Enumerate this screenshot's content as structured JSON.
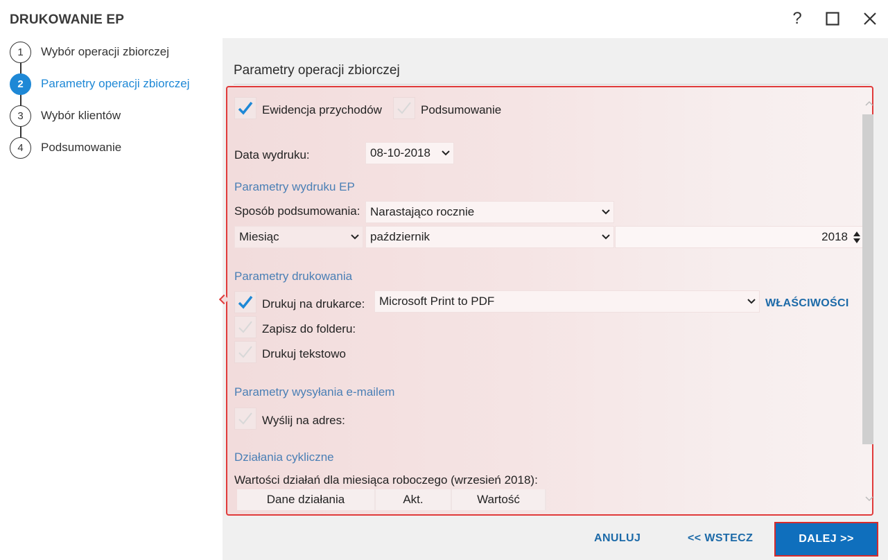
{
  "window": {
    "title": "DRUKOWANIE EP",
    "help_label": "?"
  },
  "steps": [
    {
      "number": "1",
      "label": "Wybór operacji zbiorczej",
      "active": false
    },
    {
      "number": "2",
      "label": "Parametry operacji zbiorczej",
      "active": true
    },
    {
      "number": "3",
      "label": "Wybór klientów",
      "active": false
    },
    {
      "number": "4",
      "label": "Podsumowanie",
      "active": false
    }
  ],
  "main": {
    "title": "Parametry operacji zbiorczej",
    "ewidencja": {
      "label": "Ewidencja przychodów",
      "checked": true
    },
    "podsumowanie": {
      "label": "Podsumowanie",
      "checked": false
    },
    "print_date": {
      "label": "Data wydruku:",
      "value": "08-10-2018"
    },
    "ep_section": "Parametry wydruku EP",
    "summary_mode": {
      "label": "Sposób podsumowania:",
      "value": "Narastająco rocznie"
    },
    "period_type": "Miesiąc",
    "month": "październik",
    "year": "2018",
    "print_section": "Parametry drukowania",
    "print_on_printer": {
      "label": "Drukuj na drukarce:",
      "checked": true,
      "printer": "Microsoft Print to PDF"
    },
    "properties_label": "WŁAŚCIWOŚCI",
    "save_to_folder": {
      "label": "Zapisz do folderu:",
      "checked": false
    },
    "print_text": {
      "label": "Drukuj tekstowo",
      "checked": false
    },
    "email_section": "Parametry wysyłania e-mailem",
    "send_to": {
      "label": "Wyślij na adres:",
      "checked": false
    },
    "cyclic_section": "Działania cykliczne",
    "cyclic_info": "Wartości działań dla miesiąca roboczego (wrzesień 2018):",
    "grid_columns": [
      "Dane działania",
      "Akt.",
      "Wartość"
    ]
  },
  "footer": {
    "cancel_label": "ANULUJ",
    "back_label": "<< WSTECZ",
    "next_label": "DALEJ >>"
  },
  "colors": {
    "accent": "#1e88d6",
    "link": "#1c6aa8",
    "section": "#4a7fb5",
    "panel_border": "#e03a3a",
    "next_button": "#0f6fbd"
  }
}
